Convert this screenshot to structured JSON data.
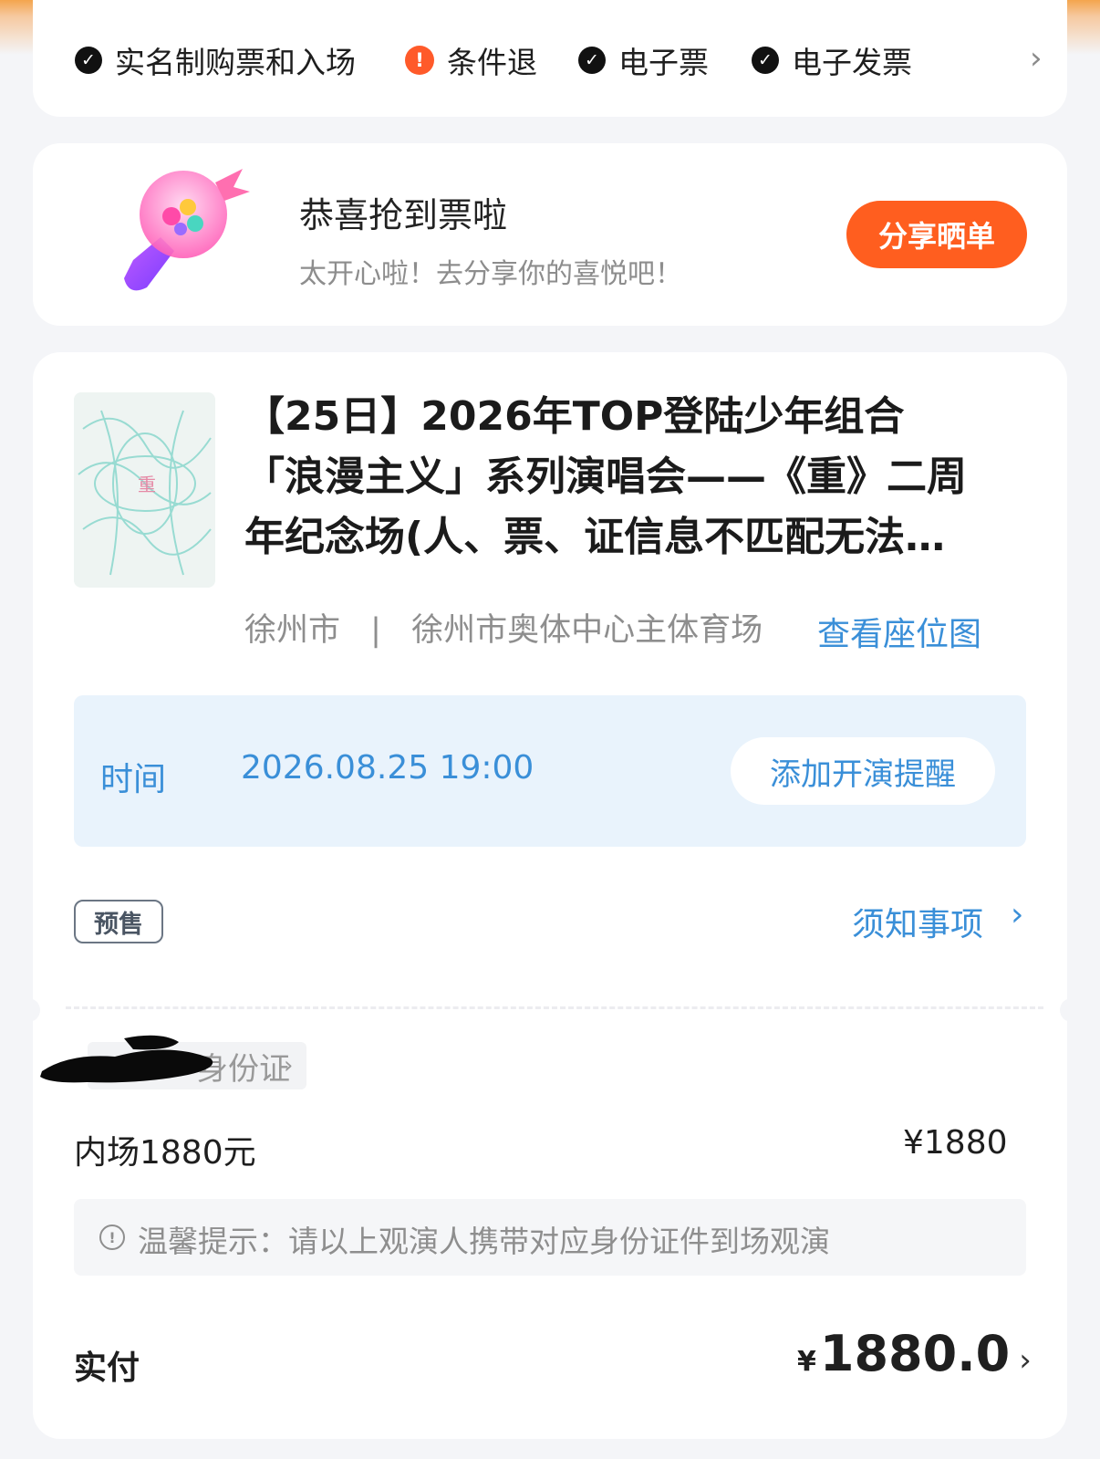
{
  "features": {
    "items": [
      {
        "label": "实名制购票和入场",
        "icon": "check-circle-icon"
      },
      {
        "label": "条件退",
        "icon": "warning-circle-icon"
      },
      {
        "label": "电子票",
        "icon": "check-circle-icon"
      },
      {
        "label": "电子发票",
        "icon": "check-circle-icon"
      }
    ],
    "more_icon": "chevron-right-icon"
  },
  "congrats": {
    "title": "恭喜抢到票啦",
    "subtitle": "太开心啦！去分享你的喜悦吧！",
    "share_label": "分享晒单",
    "illustration": "lightstick-illustration"
  },
  "event": {
    "title_lines": [
      "【25日】2026年TOP登陆少年组合",
      "「浪漫主义」系列演唱会——《重》二周",
      "年纪念场(人、票、证信息不匹配无法…"
    ],
    "poster_text": "重",
    "city": "徐州市",
    "separator": "|",
    "venue": "徐州市奥体中心主体育场",
    "seatmap_label": "查看座位图"
  },
  "schedule": {
    "time_label": "时间",
    "time_value": "2026.08.25 19:00",
    "remind_label": "添加开演提醒"
  },
  "status": {
    "presale_badge": "预售",
    "notice_label": "须知事项"
  },
  "ticket": {
    "id_label": "身份证",
    "name": "内场1880元",
    "price": "¥1880",
    "tip": "温馨提示：请以上观演人携带对应身份证件到场观演"
  },
  "payment": {
    "paid_label": "实付",
    "currency": "¥",
    "amount": "1880.0"
  },
  "colors": {
    "accent_orange": "#ff5e1f",
    "link_blue": "#3a8fd8",
    "time_bg": "#e9f3fc"
  }
}
